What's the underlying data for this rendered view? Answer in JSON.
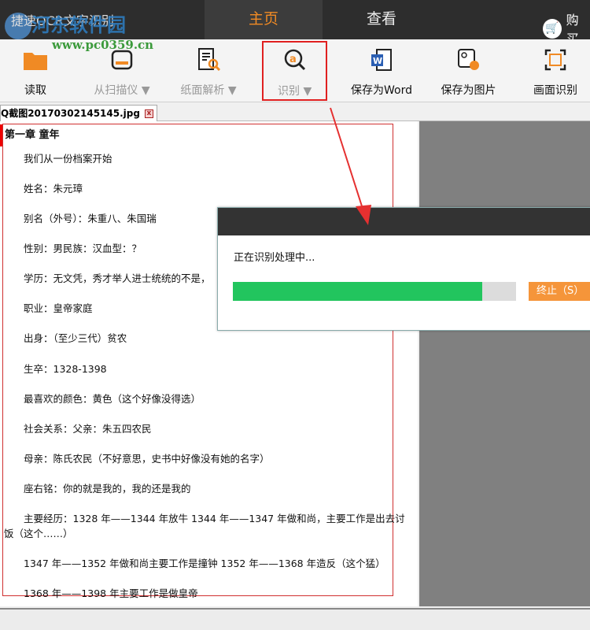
{
  "app_title": "捷速OCR文字识别",
  "watermark": {
    "name": "河东软件园",
    "url": "www.pc0359.cn"
  },
  "tabs": [
    {
      "label": "主页",
      "active": true
    },
    {
      "label": "查看",
      "active": false
    }
  ],
  "buy_label": "购买",
  "toolbar": {
    "read": "读取",
    "scanner": "从扫描仪 ▼",
    "paper": "纸面解析 ▼",
    "recognize": "识别 ▼",
    "save_word": "保存为Word",
    "save_image": "保存为图片",
    "screen_ocr": "画面识别"
  },
  "doc_tab": {
    "filename": "Q截图20170302145145.jpg",
    "close": "x"
  },
  "document": {
    "heading": "第一章 童年",
    "lines": [
      "我们从一份档案开始",
      "姓名：朱元璋",
      "别名（外号）：朱重八、朱国瑞",
      "性别：男民族：汉血型：？",
      "学历：无文凭，秀才举人进士统统的不是，",
      "职业：皇帝家庭",
      "出身：（至少三代）贫农",
      "生卒：1328-1398",
      "最喜欢的颜色：黄色（这个好像没得选）",
      "社会关系：父亲：朱五四农民",
      "母亲：陈氏农民（不好意思，史书中好像没有她的名字）",
      "座右铭：你的就是我的，我的还是我的",
      "主要经历：1328 年——1344 年放牛 1344 年——1347 年做和尚，主要工作是出去讨",
      "饭（这个……）",
      "1347 年——1352 年做和尚主要工作是撞钟 1352 年——1368 年造反（这个猛）",
      "1368 年——1398 年主要工作是做皇帝"
    ]
  },
  "dialog": {
    "message": "正在识别处理中...",
    "progress_percent": 88,
    "stop_label": "终止（S）"
  },
  "colors": {
    "accent": "#f08a24",
    "progress": "#22c55e",
    "highlight": "#e02020"
  }
}
